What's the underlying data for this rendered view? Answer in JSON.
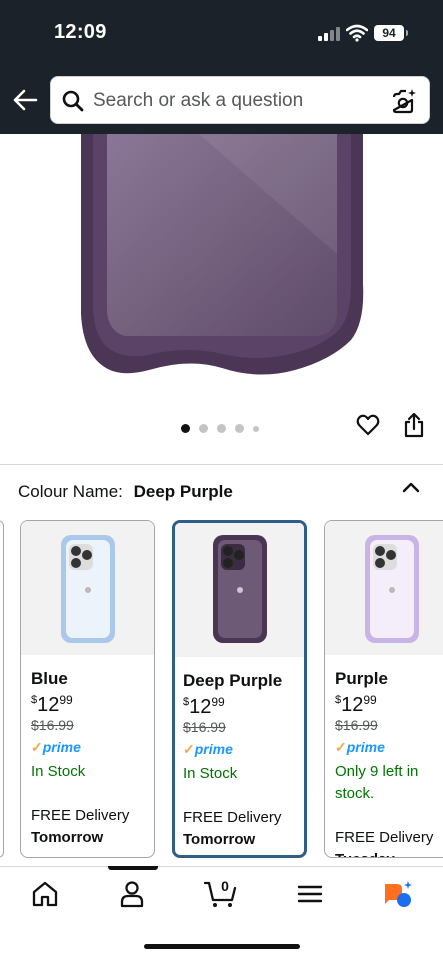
{
  "status": {
    "time": "12:09",
    "battery": "94"
  },
  "header": {
    "search_placeholder": "Search or ask a question"
  },
  "gallery": {
    "image_count": 5,
    "active_index": 0
  },
  "colour": {
    "label": "Colour Name:",
    "selected": "Deep Purple",
    "options": [
      {
        "name": "Blue",
        "price_symbol": "$",
        "price_whole": "12",
        "price_fraction": "99",
        "was": "$16.99",
        "prime": "prime",
        "stock": "In Stock",
        "delivery_label": "FREE Delivery",
        "delivery_day": "Tomorrow",
        "frame_color": "#a9c8ea"
      },
      {
        "name": "Deep Purple",
        "price_symbol": "$",
        "price_whole": "12",
        "price_fraction": "99",
        "was": "$16.99",
        "prime": "prime",
        "stock": "In Stock",
        "delivery_label": "FREE Delivery",
        "delivery_day": "Tomorrow",
        "frame_color": "#4a3553"
      },
      {
        "name": "Purple",
        "price_symbol": "$",
        "price_whole": "12",
        "price_fraction": "99",
        "was": "$16.99",
        "prime": "prime",
        "stock": "Only 9 left in stock.",
        "delivery_label": "FREE Delivery",
        "delivery_day": "Tuesday",
        "frame_color": "#c9b4e6"
      }
    ]
  },
  "nav": {
    "cart_count": "0"
  },
  "colors": {
    "header_bg": "#1c2229",
    "selected_border": "#2f5f87",
    "stock_green": "#007600",
    "prime_blue": "#1a98ff",
    "case_purple": "#4b3656"
  }
}
